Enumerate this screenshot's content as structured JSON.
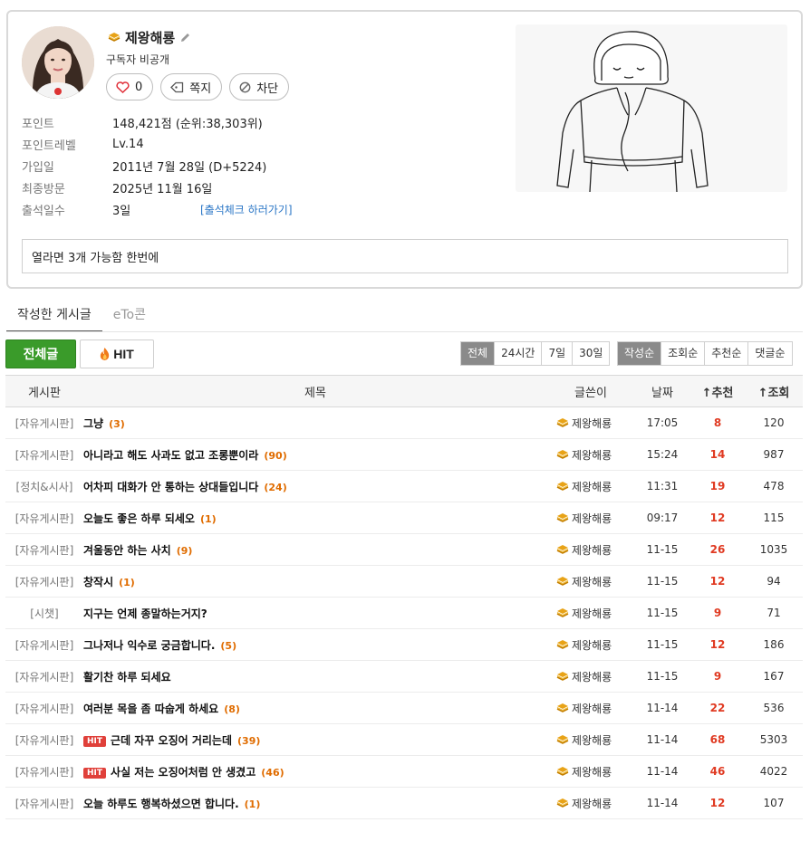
{
  "profile": {
    "nickname": "제왕해룡",
    "subscriber_text": "구독자 비공개",
    "like_count": "0",
    "message_label": "쪽지",
    "block_label": "차단",
    "info": [
      {
        "label": "포인트",
        "value": "148,421점 (순위:38,303위)"
      },
      {
        "label": "포인트레벨",
        "value": "Lv.14"
      },
      {
        "label": "가입일",
        "value": "2011년 7월 28일 (D+5224)"
      },
      {
        "label": "최종방문",
        "value": "2025년 11월 16일"
      },
      {
        "label": "출석일수",
        "value": "3일"
      }
    ],
    "attendance_link": "[출석체크 하러가기]",
    "memo": "열라면 3개 가능함 한번에"
  },
  "tabs": [
    {
      "label": "작성한 게시글"
    },
    {
      "label": "eTo콘"
    }
  ],
  "filters": {
    "all_label": "전체글",
    "hit_label": "HIT",
    "period": [
      "전체",
      "24시간",
      "7일",
      "30일"
    ],
    "sort": [
      "작성순",
      "조회순",
      "추천순",
      "댓글순"
    ]
  },
  "table": {
    "headers": {
      "board": "게시판",
      "title": "제목",
      "writer": "글쓴이",
      "date": "날짜",
      "recommend": "↑추천",
      "views": "↑조회"
    },
    "rows": [
      {
        "board": "[자유게시판]",
        "hit": false,
        "title": "그냥",
        "comments": "(3)",
        "writer": "제왕해룡",
        "date": "17:05",
        "rec": "8",
        "views": "120"
      },
      {
        "board": "[자유게시판]",
        "hit": false,
        "title": "아니라고 해도 사과도 없고 조롱뿐이라",
        "comments": "(90)",
        "writer": "제왕해룡",
        "date": "15:24",
        "rec": "14",
        "views": "987"
      },
      {
        "board": "[정치&시사]",
        "hit": false,
        "title": "어차피 대화가 안 통하는 상대들입니다",
        "comments": "(24)",
        "writer": "제왕해룡",
        "date": "11:31",
        "rec": "19",
        "views": "478"
      },
      {
        "board": "[자유게시판]",
        "hit": false,
        "title": "오늘도 좋은 하루 되세오",
        "comments": "(1)",
        "writer": "제왕해룡",
        "date": "09:17",
        "rec": "12",
        "views": "115"
      },
      {
        "board": "[자유게시판]",
        "hit": false,
        "title": "겨울동안 하는 사치",
        "comments": "(9)",
        "writer": "제왕해룡",
        "date": "11-15",
        "rec": "26",
        "views": "1035"
      },
      {
        "board": "[자유게시판]",
        "hit": false,
        "title": "창작시",
        "comments": "(1)",
        "writer": "제왕해룡",
        "date": "11-15",
        "rec": "12",
        "views": "94"
      },
      {
        "board": "[시챗]",
        "hit": false,
        "title": "지구는 언제 종말하는거지?",
        "comments": "",
        "writer": "제왕해룡",
        "date": "11-15",
        "rec": "9",
        "views": "71"
      },
      {
        "board": "[자유게시판]",
        "hit": false,
        "title": "그나저나 익수로 궁금합니다.",
        "comments": "(5)",
        "writer": "제왕해룡",
        "date": "11-15",
        "rec": "12",
        "views": "186"
      },
      {
        "board": "[자유게시판]",
        "hit": false,
        "title": "활기찬 하루 되세요",
        "comments": "",
        "writer": "제왕해룡",
        "date": "11-15",
        "rec": "9",
        "views": "167"
      },
      {
        "board": "[자유게시판]",
        "hit": false,
        "title": "여러분 목을 좀 따숩게 하세요",
        "comments": "(8)",
        "writer": "제왕해룡",
        "date": "11-14",
        "rec": "22",
        "views": "536"
      },
      {
        "board": "[자유게시판]",
        "hit": true,
        "title": "근데 자꾸 오징어 거리는데",
        "comments": "(39)",
        "writer": "제왕해룡",
        "date": "11-14",
        "rec": "68",
        "views": "5303"
      },
      {
        "board": "[자유게시판]",
        "hit": true,
        "title": "사실 저는 오징어처럼 안 생겼고",
        "comments": "(46)",
        "writer": "제왕해룡",
        "date": "11-14",
        "rec": "46",
        "views": "4022"
      },
      {
        "board": "[자유게시판]",
        "hit": false,
        "title": "오늘 하루도 행복하셨으면 합니다.",
        "comments": "(1)",
        "writer": "제왕해룡",
        "date": "11-14",
        "rec": "12",
        "views": "107"
      }
    ],
    "hit_badge": "HIT"
  },
  "colors": {
    "green": "#3a9b2a",
    "recommend_red": "#e03a22",
    "comment_orange": "#e06c00",
    "link_blue": "#2a76c6"
  }
}
